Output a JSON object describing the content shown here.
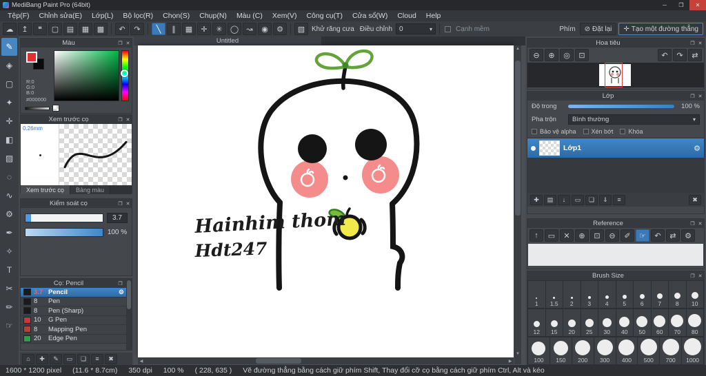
{
  "icons": {
    "close": "✕",
    "minimize": "─",
    "maximize": "❐",
    "popout": "❐",
    "undo": "↶",
    "redo": "↷",
    "gear": "⚙",
    "dropdown_arrow": "▾",
    "scroll_up": "▲",
    "scroll_down": "▼",
    "scroll_left": "◀",
    "scroll_right": "▶"
  },
  "colors": {
    "accent_blue": "#3c79b8",
    "selection_blue": "#3f86c9",
    "cheek_pink": "#f58c8c",
    "fruit_yellow": "#f2ea4a",
    "red_swatch": "#c23b3b",
    "green_swatch": "#2f9e49",
    "black_swatch": "#1a1a1a"
  },
  "titlebar": {
    "title": "MediBang Paint Pro (64bit)"
  },
  "menubar": {
    "items": [
      "Tệp(F)",
      "Chỉnh sửa(E)",
      "Lớp(L)",
      "Bộ lọc(R)",
      "Chọn(S)",
      "Chụp(N)",
      "Màu (C)",
      "Xem(V)",
      "Công cụ(T)",
      "Cửa sổ(W)",
      "Cloud",
      "Help"
    ]
  },
  "toolbar": {
    "file_icons": [
      {
        "name": "cloud",
        "glyph": "☁"
      },
      {
        "name": "publish",
        "glyph": "↥"
      },
      {
        "name": "comment",
        "glyph": "❝"
      },
      {
        "name": "new-doc",
        "glyph": "▢"
      },
      {
        "name": "open-doc",
        "glyph": "▤"
      },
      {
        "name": "grid",
        "glyph": "▦"
      },
      {
        "name": "pixel-grid",
        "glyph": "▩"
      }
    ],
    "snap_icons": [
      {
        "name": "snap-off",
        "glyph": "╲"
      },
      {
        "name": "snap-parallel",
        "glyph": "∥"
      },
      {
        "name": "snap-grid",
        "glyph": "▦"
      },
      {
        "name": "snap-cross",
        "glyph": "✛"
      },
      {
        "name": "snap-radial",
        "glyph": "✳"
      },
      {
        "name": "snap-ellipse",
        "glyph": "◯"
      },
      {
        "name": "snap-curve",
        "glyph": "↝"
      },
      {
        "name": "snap-focus",
        "glyph": "◉"
      },
      {
        "name": "snap-settings",
        "glyph": "⚙"
      }
    ],
    "khu_rang_cua": "Khử răng cưa",
    "dieu_chinh_label": "Điều chỉnh",
    "dieu_chinh_value": "0",
    "canh_mem": "Cạnh mềm",
    "phim": "Phím",
    "dat_lai": "Đặt lại",
    "dat_lai_glyph": "⊘",
    "tao_duong_thang": "Tạo một đường thẳng",
    "tao_duong_thang_glyph": "✛"
  },
  "tools": [
    {
      "name": "brush-tool",
      "glyph": "✎"
    },
    {
      "name": "eraser-tool",
      "glyph": "◈"
    },
    {
      "name": "select-tool",
      "glyph": "▢"
    },
    {
      "name": "magic-wand-tool",
      "glyph": "✦"
    },
    {
      "name": "move-tool",
      "glyph": "✛"
    },
    {
      "name": "fill-tool",
      "glyph": "◧"
    },
    {
      "name": "gradient-tool",
      "glyph": "▨"
    },
    {
      "name": "ellipse-select-tool",
      "glyph": "◌"
    },
    {
      "name": "lasso-tool",
      "glyph": "∿"
    },
    {
      "name": "operation-tool",
      "glyph": "⚙"
    },
    {
      "name": "pen-tool",
      "glyph": "✒"
    },
    {
      "name": "eyedropper-tool",
      "glyph": "✧"
    },
    {
      "name": "text-tool",
      "glyph": "T"
    },
    {
      "name": "scissors-tool",
      "glyph": "✂"
    },
    {
      "name": "pencil-tool",
      "glyph": "✏"
    },
    {
      "name": "hand-tool",
      "glyph": "☞"
    }
  ],
  "panels": {
    "mau": {
      "title": "Màu",
      "r": "R:0",
      "g": "G:0",
      "b": "B:0",
      "hex": "#000000"
    },
    "xem_truoc": {
      "title": "Xem trước cọ",
      "size_label": "0.26mm",
      "tabs": [
        "Xem trước cọ",
        "Bảng màu"
      ]
    },
    "kiem_soat": {
      "title": "Kiểm soát cọ",
      "size_value": "3.7",
      "opacity_value": "100 %"
    },
    "brushes": {
      "title": "Cọ: Pencil",
      "items": [
        {
          "size": "3.7",
          "name": "Pencil",
          "swatch": "#1a1a1a"
        },
        {
          "size": "8",
          "name": "Pen",
          "swatch": "#1a1a1a"
        },
        {
          "size": "8",
          "name": "Pen (Sharp)",
          "swatch": "#1a1a1a"
        },
        {
          "size": "10",
          "name": "G Pen",
          "swatch": "#c23b3b"
        },
        {
          "size": "8",
          "name": "Mapping Pen",
          "swatch": "#c23b3b"
        },
        {
          "size": "20",
          "name": "Edge Pen",
          "swatch": "#2f9e49"
        }
      ]
    }
  },
  "canvas": {
    "tab": "Untitled",
    "annotation_line1": "Hainhim thom",
    "annotation_line2": "Hdt247"
  },
  "right": {
    "hoa_tieu": {
      "title": "Hoa tiêu"
    },
    "lop": {
      "title": "Lớp",
      "do_trong": "Độ trong",
      "do_trong_value": "100 %",
      "pha_tron": "Pha trộn",
      "blend_value": "Bình thường",
      "bao_ve_alpha": "Bảo vệ alpha",
      "xen_bot": "Xén bớt",
      "khoa": "Khóa",
      "layer1": "Lớp1"
    },
    "reference": {
      "title": "Reference"
    },
    "brush_size": {
      "title": "Brush Size",
      "rows": [
        {
          "sizes": [
            "1",
            "1.5",
            "2",
            "3",
            "4",
            "5",
            "6",
            "7",
            "8",
            "10"
          ]
        },
        {
          "sizes": [
            "12",
            "15",
            "20",
            "25",
            "30",
            "40",
            "50",
            "60",
            "70",
            "80"
          ]
        },
        {
          "sizes": [
            "100",
            "150",
            "200",
            "300",
            "400",
            "500",
            "700",
            "1000"
          ]
        }
      ]
    }
  },
  "statusbar": {
    "segments": [
      "1600 * 1200 pixel",
      "(11.6 * 8.7cm)",
      "350 dpi",
      "100 %",
      "( 228, 635 )",
      "Vẽ đường thẳng bằng cách giữ phím Shift, Thay đổi cỡ cọ bằng cách giữ phím Ctrl, Alt và kéo"
    ]
  }
}
